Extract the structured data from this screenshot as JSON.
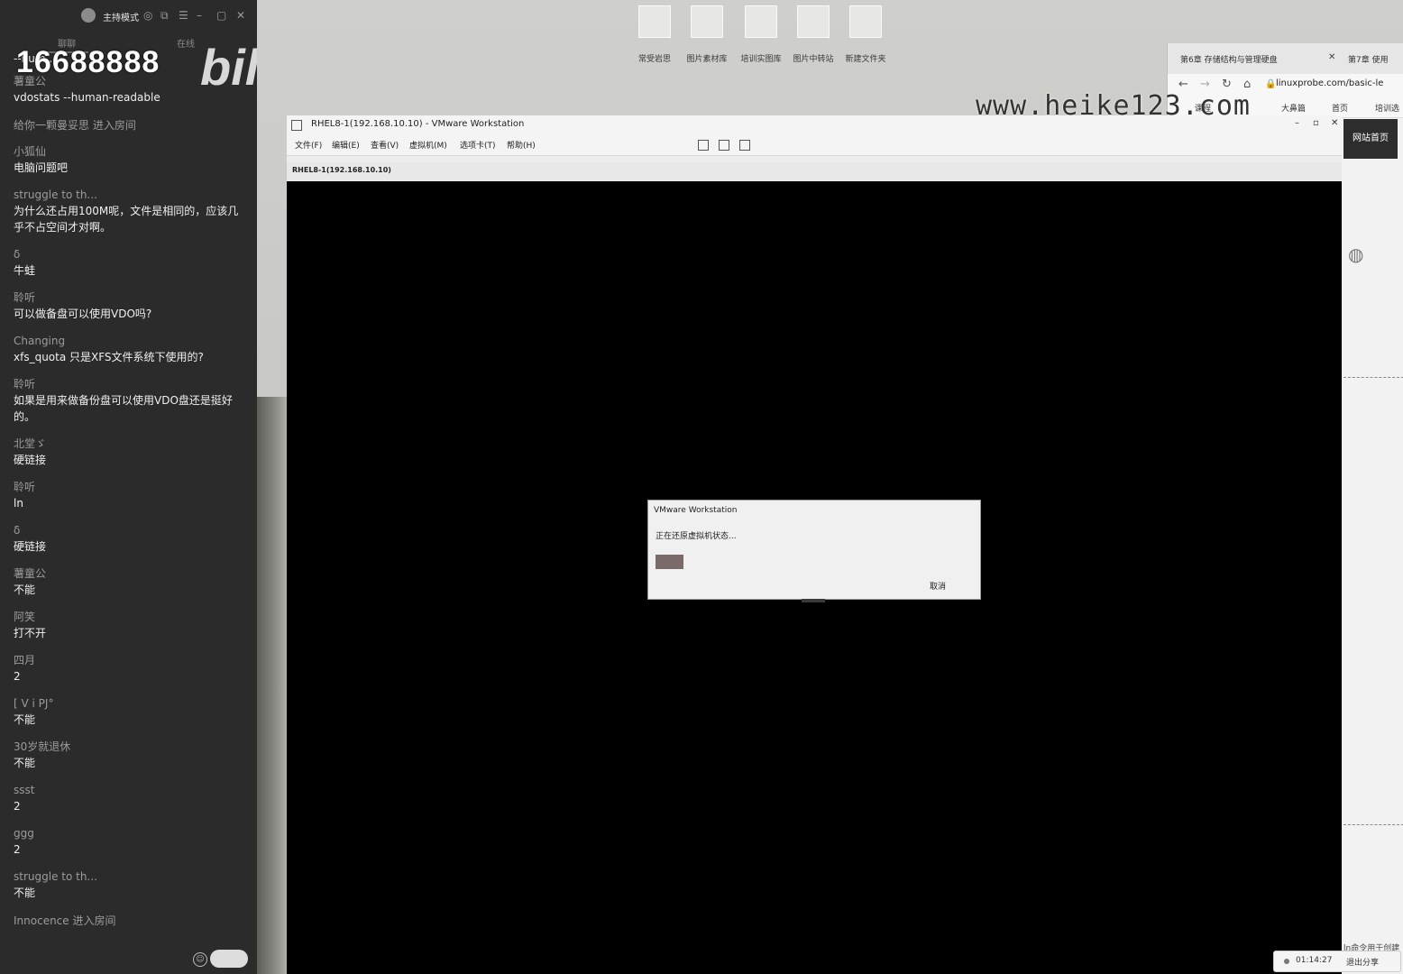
{
  "chat": {
    "host_mode": "主持模式",
    "tabs": [
      "聊聊",
      "在线"
    ],
    "watermark_number": "16688888",
    "bili_logo": "bilibili",
    "first_line": "--hum...",
    "messages": [
      {
        "user": "薯童公",
        "text": "vdostats --human-readable"
      },
      {
        "notice": "给你一颗曼妥思 进入房间"
      },
      {
        "user": "小狐仙",
        "text": "电脑问题吧"
      },
      {
        "user": "struggle to th...",
        "text": "为什么还占用100M呢，文件是相同的，应该几乎不占空间才对啊。"
      },
      {
        "user": "δ",
        "text": "牛蛙"
      },
      {
        "user": "聆听",
        "text": "可以做备盘可以使用VDO吗?"
      },
      {
        "user": "Changing",
        "text": "xfs_quota 只是XFS文件系统下使用的?"
      },
      {
        "user": "聆听",
        "text": "如果是用来做备份盘可以使用VDO盘还是挺好的。"
      },
      {
        "user": "北堂ゞ",
        "text": "硬链接"
      },
      {
        "user": "聆听",
        "text": "ln"
      },
      {
        "user": "δ",
        "text": "硬链接"
      },
      {
        "user": "薯童公",
        "text": "不能"
      },
      {
        "user": "阿笑",
        "text": "打不开"
      },
      {
        "user": "四月",
        "text": "2"
      },
      {
        "user": "[ V i PJ°",
        "text": "不能"
      },
      {
        "user": "30岁就退休",
        "text": "不能"
      },
      {
        "user": "ssst",
        "text": "2"
      },
      {
        "user": "ggg",
        "text": "2"
      },
      {
        "user": "struggle to th...",
        "text": "不能"
      },
      {
        "notice": "Innocence 进入房间"
      }
    ]
  },
  "desktop": {
    "icons": [
      "常受岩思",
      "图片素材库",
      "培训实图库",
      "图片中转站",
      "新建文件夹"
    ]
  },
  "browser": {
    "tab1": "第6章 存储结构与管理硬盘",
    "tab2": "第7章 使用",
    "url": "linuxprobe.com/basic-le",
    "bookmarks": [
      "课程",
      "大鼻篇",
      "首页",
      "培训选"
    ],
    "site_button": "网站首页",
    "footer_text": "ln命令用于创建"
  },
  "share_bar": {
    "time": "01:14:27",
    "stop_label": "退出分享"
  },
  "vmware": {
    "title": "RHEL8-1(192.168.10.10) - VMware Workstation",
    "menus": [
      "文件(F)",
      "编辑(E)",
      "查看(V)",
      "虚拟机(M)",
      "选项卡(T)",
      "帮助(H)"
    ],
    "tab_label": "RHEL8-1(192.168.10.10)",
    "dialog": {
      "title": "VMware Workstation",
      "message": "正在还原虚拟机状态...",
      "progress": 0.26,
      "cancel": "取消"
    }
  },
  "site_watermark": "www.heike123.com"
}
